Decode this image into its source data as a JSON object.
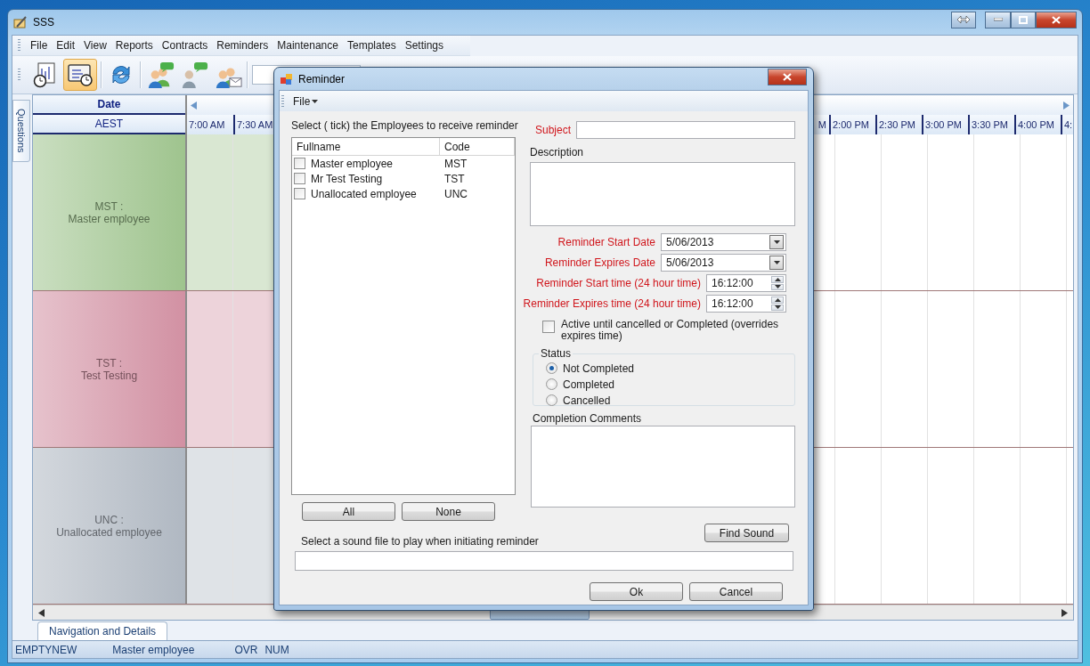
{
  "window": {
    "title": "SSS"
  },
  "menu": [
    "File",
    "Edit",
    "View",
    "Reports",
    "Contracts",
    "Reminders",
    "Maintenance",
    "Templates",
    "Settings"
  ],
  "toolbar": [
    {
      "kind": "chart-clock",
      "selected": false
    },
    {
      "kind": "calendar-clock",
      "selected": true
    },
    {
      "kind": "separator"
    },
    {
      "kind": "refresh",
      "selected": false
    },
    {
      "kind": "separator"
    },
    {
      "kind": "group-sms",
      "selected": false
    },
    {
      "kind": "person-sms",
      "selected": false
    },
    {
      "kind": "group-mail",
      "selected": false
    },
    {
      "kind": "separator"
    },
    {
      "kind": "field"
    }
  ],
  "side_tab": {
    "label": "Questions"
  },
  "schedule": {
    "date_header": "Date",
    "timezone": "AEST",
    "time_slots_left": [
      "7:00 AM",
      "7:30 AM"
    ],
    "time_slots_right": [
      "M",
      "2:00 PM",
      "2:30 PM",
      "3:00 PM",
      "3:30 PM",
      "4:00 PM",
      "4:"
    ],
    "employees": [
      {
        "label": "MST :",
        "name": "Master employee",
        "color": "#9fc48e"
      },
      {
        "label": "TST :",
        "name": "Test Testing",
        "color": "#d291a3"
      },
      {
        "label": "UNC :",
        "name": "Unallocated employee",
        "color": "#b0b8c2"
      }
    ]
  },
  "bottom_tab": {
    "label": "Navigation and Details",
    "selected": true
  },
  "status_bar": [
    "EMPTYNEW",
    "Master employee",
    "OVR",
    "NUM"
  ],
  "dialog": {
    "title": "Reminder",
    "menu": [
      "File"
    ],
    "employees_label": "Select ( tick) the Employees to receive reminder",
    "columns": [
      "Fullname",
      "Code"
    ],
    "employees": [
      {
        "name": "Master employee",
        "code": "MST",
        "checked": false
      },
      {
        "name": "Mr Test Testing",
        "code": "TST",
        "checked": false
      },
      {
        "name": "Unallocated employee",
        "code": "UNC",
        "checked": false
      }
    ],
    "list_buttons": [
      "All",
      "None"
    ],
    "subject": {
      "label": "Subject",
      "required": true
    },
    "description": {
      "label": "Description",
      "required": false
    },
    "dates": [
      {
        "label": "Reminder Start Date",
        "value": "5/06/2013",
        "required": true
      },
      {
        "label": "Reminder Expires Date",
        "value": "5/06/2013",
        "required": true
      }
    ],
    "times": [
      {
        "label": "Reminder Start time (24 hour time)",
        "value": "16:12:00",
        "required": true
      },
      {
        "label": "Reminder Expires time (24 hour time)",
        "value": "16:12:00",
        "required": true
      }
    ],
    "active_until": {
      "label": "Active until cancelled or Completed (overrides expires time)",
      "checked": false
    },
    "status": {
      "label": "Status",
      "options": [
        {
          "label": "Not Completed",
          "selected": true
        },
        {
          "label": "Completed",
          "selected": false
        },
        {
          "label": "Cancelled",
          "selected": false
        }
      ]
    },
    "completion_comments": {
      "label": "Completion Comments",
      "required": false
    },
    "find_sound": "Find Sound",
    "sound": {
      "label": "Select a sound file to play when initiating reminder"
    },
    "buttons": [
      "Ok",
      "Cancel"
    ]
  }
}
